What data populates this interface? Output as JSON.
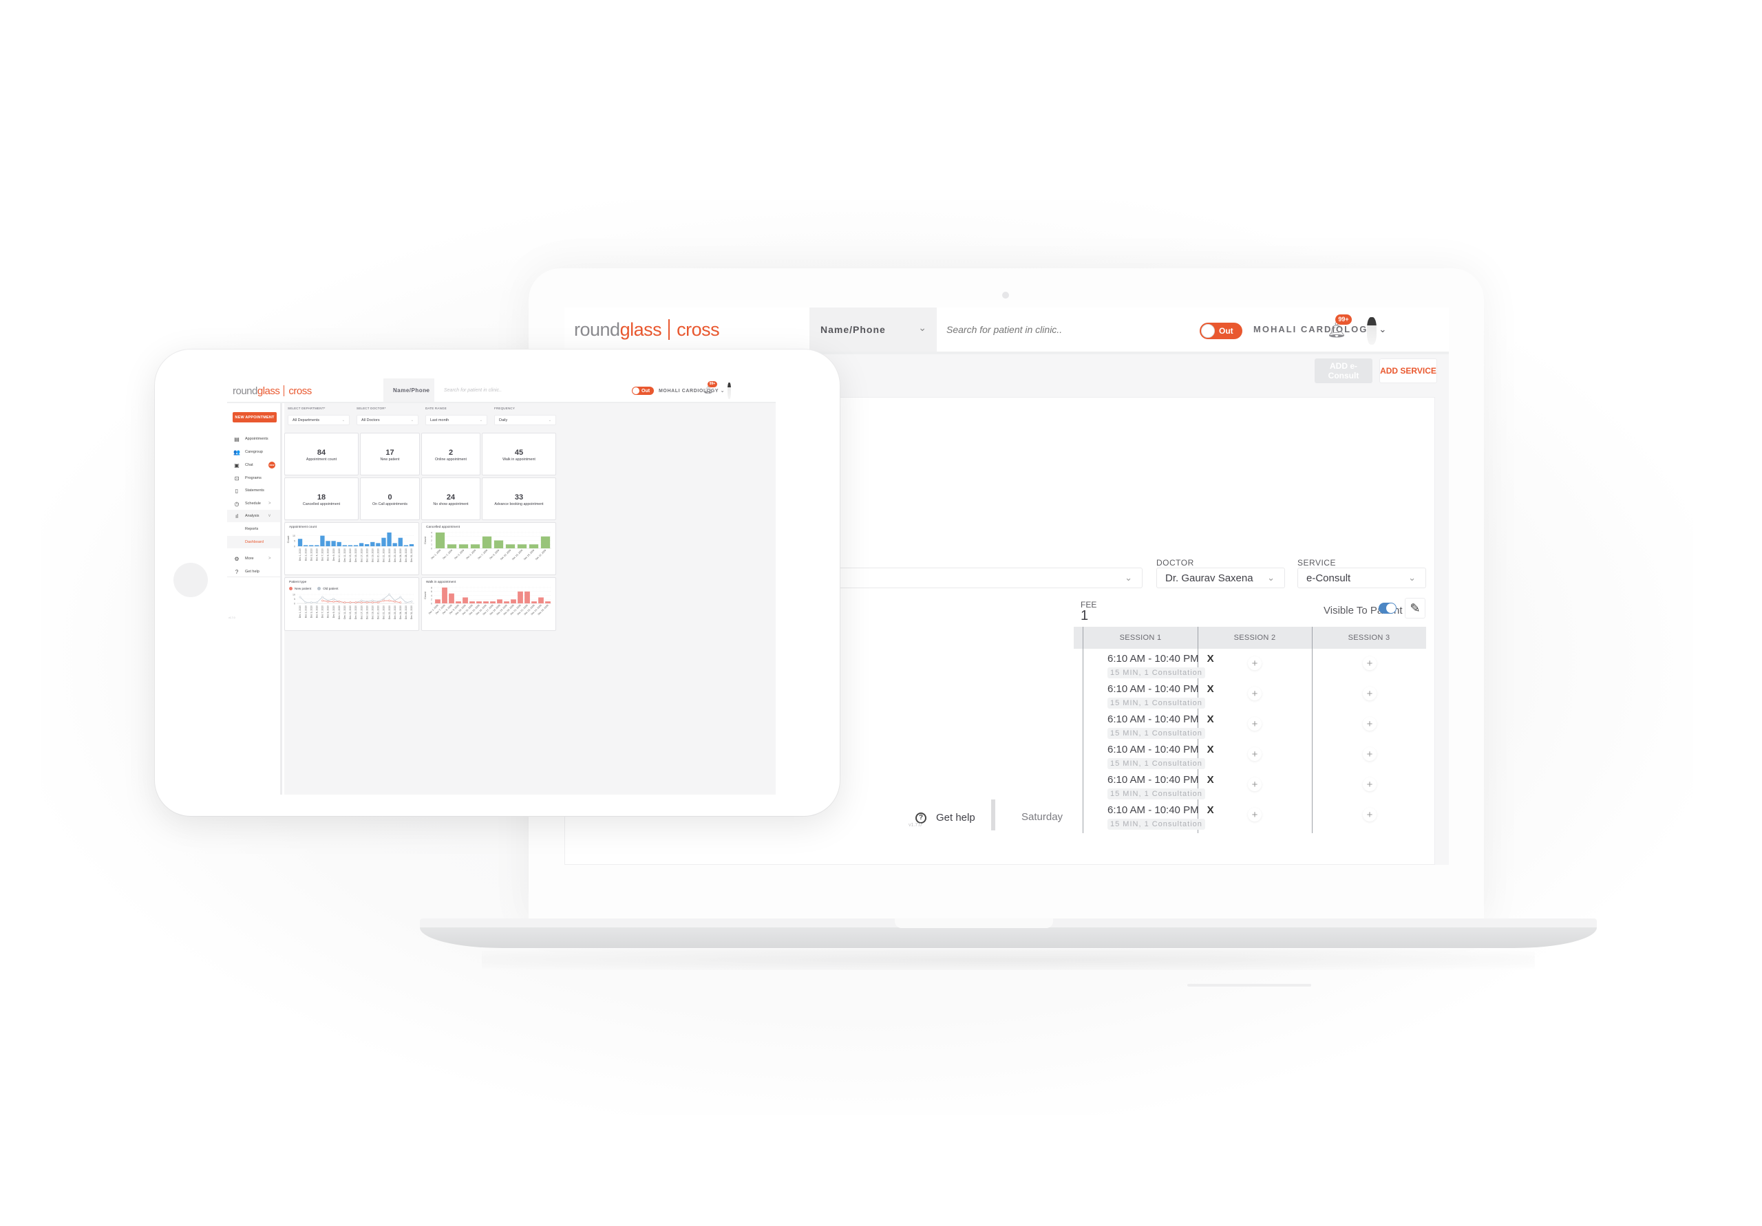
{
  "brand": {
    "logo_part1": "round",
    "logo_part2": "glass",
    "logo_part3": "cross",
    "accent_color": "#e9582f"
  },
  "laptop": {
    "header": {
      "search_type": "Name/Phone",
      "search_placeholder": "Search for patient in clinic..",
      "status_toggle": "Out",
      "clinic": "MOHALI CARDIOLOGY",
      "notifications_badge": "99+"
    },
    "actions": {
      "add_econsult": "ADD e-Consult",
      "add_service": "ADD SERVICE"
    },
    "filters": {
      "doctor_label": "DOCTOR",
      "doctor_value": "Dr. Gaurav Saxena",
      "service_label": "SERVICE",
      "service_value": "e-Consult"
    },
    "fee": {
      "label": "FEE",
      "value": "1"
    },
    "visible_to_patient": {
      "label": "Visible To Patient",
      "enabled": true
    },
    "schedule": {
      "columns": [
        "SESSION 1",
        "SESSION 2",
        "SESSION 3"
      ],
      "rows": [
        {
          "time": "6:10 AM - 10:40 PM",
          "meta": "15 MIN, 1 Consultation"
        },
        {
          "time": "6:10 AM - 10:40 PM",
          "meta": "15 MIN, 1 Consultation"
        },
        {
          "time": "6:10 AM - 10:40 PM",
          "meta": "15 MIN, 1 Consultation"
        },
        {
          "time": "6:10 AM - 10:40 PM",
          "meta": "15 MIN, 1 Consultation"
        },
        {
          "time": "6:10 AM - 10:40 PM",
          "meta": "15 MIN, 1 Consultation"
        },
        {
          "time": "6:10 AM - 10:40 PM",
          "meta": "15 MIN, 1 Consultation"
        }
      ],
      "remove_glyph": "X",
      "add_glyph": "+",
      "last_day": "Saturday"
    },
    "sidebar": {
      "get_help": "Get help",
      "version": "v1.7.0"
    }
  },
  "tablet": {
    "header": {
      "search_type": "Name/Phone",
      "search_placeholder": "Search for patient in clinic..",
      "status_toggle": "Out",
      "clinic": "MOHALI CARDIOLOGY",
      "notifications_badge": "99+"
    },
    "sidebar": {
      "new_appointment": "NEW APPOINTMENT",
      "items": [
        {
          "label": "Appointments",
          "icon": "calendar-icon",
          "glyph": "▤"
        },
        {
          "label": "Caregroup",
          "icon": "users-icon",
          "glyph": "👥"
        },
        {
          "label": "Chat",
          "icon": "chat-icon",
          "glyph": "▣",
          "badge": "NEW"
        },
        {
          "label": "Programs",
          "icon": "programs-icon",
          "glyph": "⊡"
        },
        {
          "label": "Statements",
          "icon": "document-icon",
          "glyph": "▯"
        },
        {
          "label": "Schedule",
          "icon": "clock-icon",
          "glyph": "◷",
          "arrow": ">"
        },
        {
          "label": "Analysis",
          "icon": "bar-chart-icon",
          "glyph": "ıl",
          "arrow": "v"
        },
        {
          "label": "Reports"
        },
        {
          "label": "Dashboard",
          "active": true
        },
        {
          "label": "More",
          "icon": "gear-icon",
          "glyph": "⚙",
          "arrow": ">"
        },
        {
          "label": "Get help",
          "icon": "help-icon",
          "glyph": "?"
        }
      ],
      "version": "v1.7.0"
    },
    "filters": [
      {
        "label": "SELECT DEPARTMENT*",
        "value": "All Departments"
      },
      {
        "label": "SELECT DOCTOR*",
        "value": "All Doctors"
      },
      {
        "label": "DATE RANGE",
        "value": "Last month"
      },
      {
        "label": "FREQUENCY",
        "value": "Daily"
      }
    ],
    "stats": [
      {
        "value": "84",
        "label": "Appointment count"
      },
      {
        "value": "17",
        "label": "New patient"
      },
      {
        "value": "2",
        "label": "Online appointment"
      },
      {
        "value": "45",
        "label": "Walk in appointment"
      },
      {
        "value": "18",
        "label": "Cancelled appointment"
      },
      {
        "value": "0",
        "label": "On Call appointments"
      },
      {
        "value": "24",
        "label": "No show appointment"
      },
      {
        "value": "33",
        "label": "Advance booking appointment"
      }
    ]
  },
  "chart_data": [
    {
      "type": "bar",
      "title": "Appointment count",
      "xlabel": "",
      "ylabel": "Count",
      "ylim": [
        0,
        13
      ],
      "yticks": [
        0,
        5,
        10
      ],
      "color": "#4d9de0",
      "rotate_labels": 90,
      "grid": true,
      "categories": [
        "Dec 1, 2020",
        "Dec 2, 2020",
        "Dec 3, 2020",
        "Dec 4, 2020",
        "Dec 7, 2020",
        "Dec 8, 2020",
        "Dec 9, 2020",
        "Dec 10, 2020",
        "Dec 11, 2020",
        "Dec 15, 2020",
        "Dec 16, 2020",
        "Dec 17, 2020",
        "Dec 18, 2020",
        "Dec 19, 2020",
        "Dec 20, 2020",
        "Dec 21, 2020",
        "Dec 22, 2020",
        "Dec 23, 2020",
        "Dec 24, 2020",
        "Dec 28, 2020",
        "Dec 31, 2020"
      ],
      "values": [
        7,
        1,
        1,
        1,
        10,
        5,
        5,
        4,
        1,
        1,
        1,
        3,
        2,
        4,
        3,
        8,
        13,
        3,
        8,
        1,
        2
      ]
    },
    {
      "type": "bar",
      "title": "Cancelled appointment",
      "xlabel": "",
      "ylabel": "Count",
      "ylim": [
        0,
        4
      ],
      "yticks": [
        0,
        1,
        2,
        3,
        4
      ],
      "color": "#98c479",
      "rotate_labels": 45,
      "grid": true,
      "categories": [
        "Dec 1, 2020",
        "Dec 2, 2020",
        "Dec 3, 2020",
        "Dec 4, 2020",
        "Dec 7, 2020",
        "Dec 8, 2020",
        "Dec 10, 2020",
        "Dec 18, 2020",
        "Dec 19, 2020",
        "Dec 22, 2020"
      ],
      "values": [
        4,
        1,
        1,
        1,
        3,
        2,
        1,
        1,
        1,
        3
      ]
    },
    {
      "type": "line",
      "title": "Patient type",
      "xlabel": "",
      "ylabel": "",
      "ylim": [
        0,
        10
      ],
      "yticks": [
        0,
        5,
        10
      ],
      "rotate_labels": 90,
      "grid": true,
      "legend": "top-left",
      "categories": [
        "Dec 1, 2020",
        "Dec 2, 2020",
        "Dec 3, 2020",
        "Dec 4, 2020",
        "Dec 7, 2020",
        "Dec 8, 2020",
        "Dec 9, 2020",
        "Dec 10, 2020",
        "Dec 11, 2020",
        "Dec 15, 2020",
        "Dec 16, 2020",
        "Dec 17, 2020",
        "Dec 18, 2020",
        "Dec 19, 2020",
        "Dec 20, 2020",
        "Dec 21, 2020",
        "Dec 22, 2020",
        "Dec 23, 2020",
        "Dec 24, 2020",
        "Dec 28, 2020",
        "Dec 31, 2020"
      ],
      "series": [
        {
          "name": "New patient",
          "color": "#ef7a6b",
          "values": [
            null,
            null,
            null,
            null,
            3,
            2,
            2,
            2,
            1,
            1,
            1,
            1,
            1,
            1,
            1,
            3,
            3,
            2,
            1,
            null,
            null
          ]
        },
        {
          "name": "Old patient",
          "color": "#b9c3cc",
          "values": [
            7,
            1,
            1,
            1,
            7,
            3,
            5,
            2,
            1,
            1,
            1,
            3,
            2,
            3,
            2,
            5,
            10,
            3,
            7,
            1,
            2
          ]
        }
      ]
    },
    {
      "type": "bar",
      "title": "Walk in appointment",
      "xlabel": "",
      "ylabel": "Count",
      "ylim": [
        0,
        8
      ],
      "yticks": [
        0,
        2,
        4,
        6,
        8
      ],
      "color": "#f08a86",
      "rotate_labels": 45,
      "grid": true,
      "categories": [
        "Dec 1, 2020",
        "Dec 7, 2020",
        "Dec 8, 2020",
        "Dec 9, 2020",
        "Dec 10, 2020",
        "Dec 11, 2020",
        "Dec 15, 2020",
        "Dec 16, 2020",
        "Dec 17, 2020",
        "Dec 18, 2020",
        "Dec 19, 2020",
        "Dec 20, 2020",
        "Dec 21, 2020",
        "Dec 22, 2020",
        "Dec 23, 2020",
        "Dec 24, 2020",
        "Dec 28, 2020"
      ],
      "values": [
        2,
        8,
        5,
        1,
        3,
        1,
        1,
        1,
        1,
        2,
        1,
        2,
        6,
        6,
        1,
        3,
        1
      ]
    }
  ]
}
